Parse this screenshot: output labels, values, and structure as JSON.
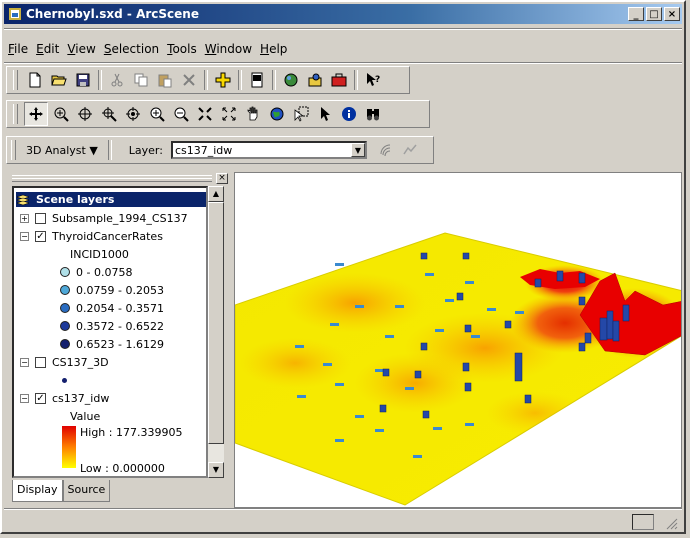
{
  "window": {
    "title": "Chernobyl.sxd - ArcScene",
    "controls": [
      "minimize",
      "maximize",
      "close"
    ]
  },
  "menu": [
    "File",
    "Edit",
    "View",
    "Selection",
    "Tools",
    "Window",
    "Help"
  ],
  "toolbar1_icons": [
    "new-icon",
    "open-icon",
    "save-icon",
    "cut-icon",
    "copy-icon",
    "paste-icon",
    "delete-icon",
    "add-data-icon",
    "scene-properties-icon",
    "arcmap-icon",
    "arccatalog-icon",
    "arctoolbox-icon",
    "whats-this-icon"
  ],
  "toolbar2_icons": [
    "navigate-icon",
    "fly-icon",
    "target-icon",
    "zoom-to-target-icon",
    "center-target-icon",
    "zoom-in-icon",
    "zoom-out-icon",
    "zoom-in-fixed-icon",
    "zoom-out-fixed-icon",
    "pan-icon",
    "full-extent-icon",
    "select-graphics-icon",
    "select-icon",
    "identify-icon",
    "find-icon"
  ],
  "analyst": {
    "dropdown_label": "3D Analyst",
    "layer_label": "Layer:",
    "layer_value": "cs137_idw"
  },
  "toc": {
    "header": "Scene layers",
    "layers": [
      {
        "name": "Subsample_1994_CS137",
        "expanded": false,
        "checked": false
      },
      {
        "name": "ThyroidCancerRates",
        "expanded": true,
        "checked": true
      },
      {
        "name": "CS137_3D",
        "expanded": true,
        "checked": false
      },
      {
        "name": "cs137_idw",
        "expanded": true,
        "checked": true
      }
    ],
    "thyroid_field": "INCID1000",
    "thyroid_classes": [
      {
        "label": "0 - 0.0758",
        "color": "#b0e0e8"
      },
      {
        "label": "0.0759 - 0.2053",
        "color": "#4ea8d8"
      },
      {
        "label": "0.2054 - 0.3571",
        "color": "#2a6cc0"
      },
      {
        "label": "0.3572 - 0.6522",
        "color": "#1e3a9a"
      },
      {
        "label": "0.6523 - 1.6129",
        "color": "#14206e"
      }
    ],
    "idw_value_label": "Value",
    "idw_high": "High : 177.339905",
    "idw_low": "Low : 0.000000",
    "tabs": [
      "Display",
      "Source"
    ]
  },
  "colors": {
    "ramp_high": "#e00000",
    "ramp_low": "#ffff00",
    "surface_base": "#f2e400"
  }
}
